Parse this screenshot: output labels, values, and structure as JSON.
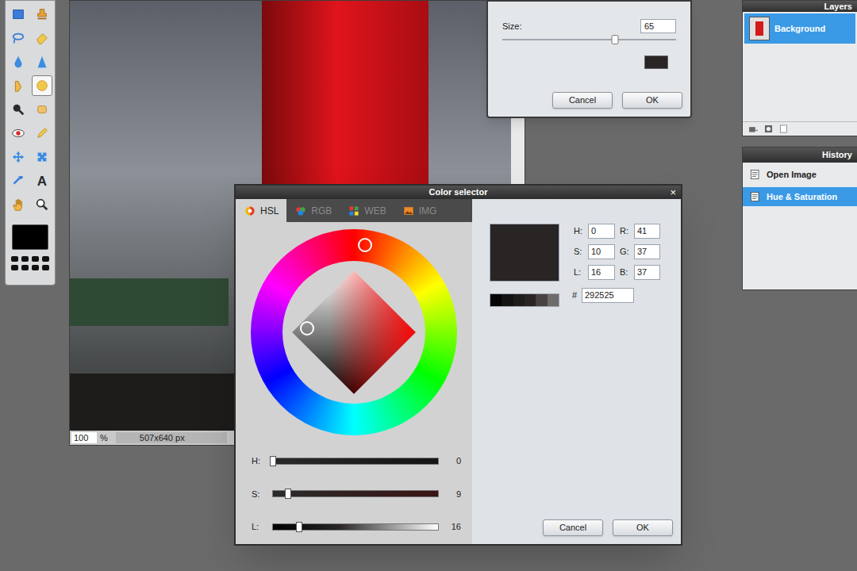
{
  "toolbar": {
    "tools": [
      {
        "selected": false
      },
      {
        "selected": false
      },
      {
        "selected": false
      },
      {
        "selected": false
      },
      {
        "selected": false
      },
      {
        "selected": false
      },
      {
        "selected": false
      },
      {
        "selected": true
      },
      {
        "selected": false
      },
      {
        "selected": false
      },
      {
        "selected": false
      },
      {
        "selected": false
      },
      {
        "selected": false
      },
      {
        "selected": false
      },
      {
        "selected": false
      },
      {
        "selected": false,
        "glyph": "A"
      },
      {
        "selected": false
      },
      {
        "selected": false
      }
    ],
    "color": "#000000"
  },
  "canvas": {
    "zoom": "100",
    "zoom_unit": "%",
    "dimensions": "507x640 px"
  },
  "brush_dialog": {
    "size_label": "Size:",
    "size": "65",
    "level": 0.65,
    "color": "#2a2525",
    "buttons": [
      "Cancel",
      "OK"
    ]
  },
  "layers": {
    "title": "Layers",
    "items": [
      {
        "name": "Background",
        "selected": true
      }
    ]
  },
  "history": {
    "title": "History",
    "items": [
      {
        "label": "Open Image",
        "selected": false
      },
      {
        "label": "Hue & Saturation",
        "selected": true
      }
    ]
  },
  "color_selector": {
    "title": "Color selector",
    "close": "×",
    "tabs": [
      {
        "label": "HSL",
        "selected": true
      },
      {
        "label": "RGB",
        "selected": false
      },
      {
        "label": "WEB",
        "selected": false
      },
      {
        "label": "IMG",
        "selected": false
      }
    ],
    "hue_level": 0.02,
    "marker": {
      "x_level": 0.12,
      "y_level": 0.47
    },
    "color": "#292525",
    "shades": [
      "#050505",
      "#141212",
      "#1f1c1c",
      "#292525",
      "#474343",
      "#6e6b6b"
    ],
    "hsl_fields": [
      {
        "label": "H:",
        "value": "0"
      },
      {
        "label": "S:",
        "value": "10"
      },
      {
        "label": "L:",
        "value": "16"
      }
    ],
    "rgb_fields": [
      {
        "label": "R:",
        "value": "41"
      },
      {
        "label": "G:",
        "value": "37"
      },
      {
        "label": "B:",
        "value": "37"
      }
    ],
    "hex": {
      "label": "#",
      "value": "292525"
    },
    "sliders": [
      {
        "label": "H:",
        "value": "0",
        "level": 0.0
      },
      {
        "label": "S:",
        "value": "9",
        "level": 0.09
      },
      {
        "label": "L:",
        "value": "16",
        "level": 0.16
      }
    ],
    "buttons": [
      "Cancel",
      "OK"
    ]
  }
}
